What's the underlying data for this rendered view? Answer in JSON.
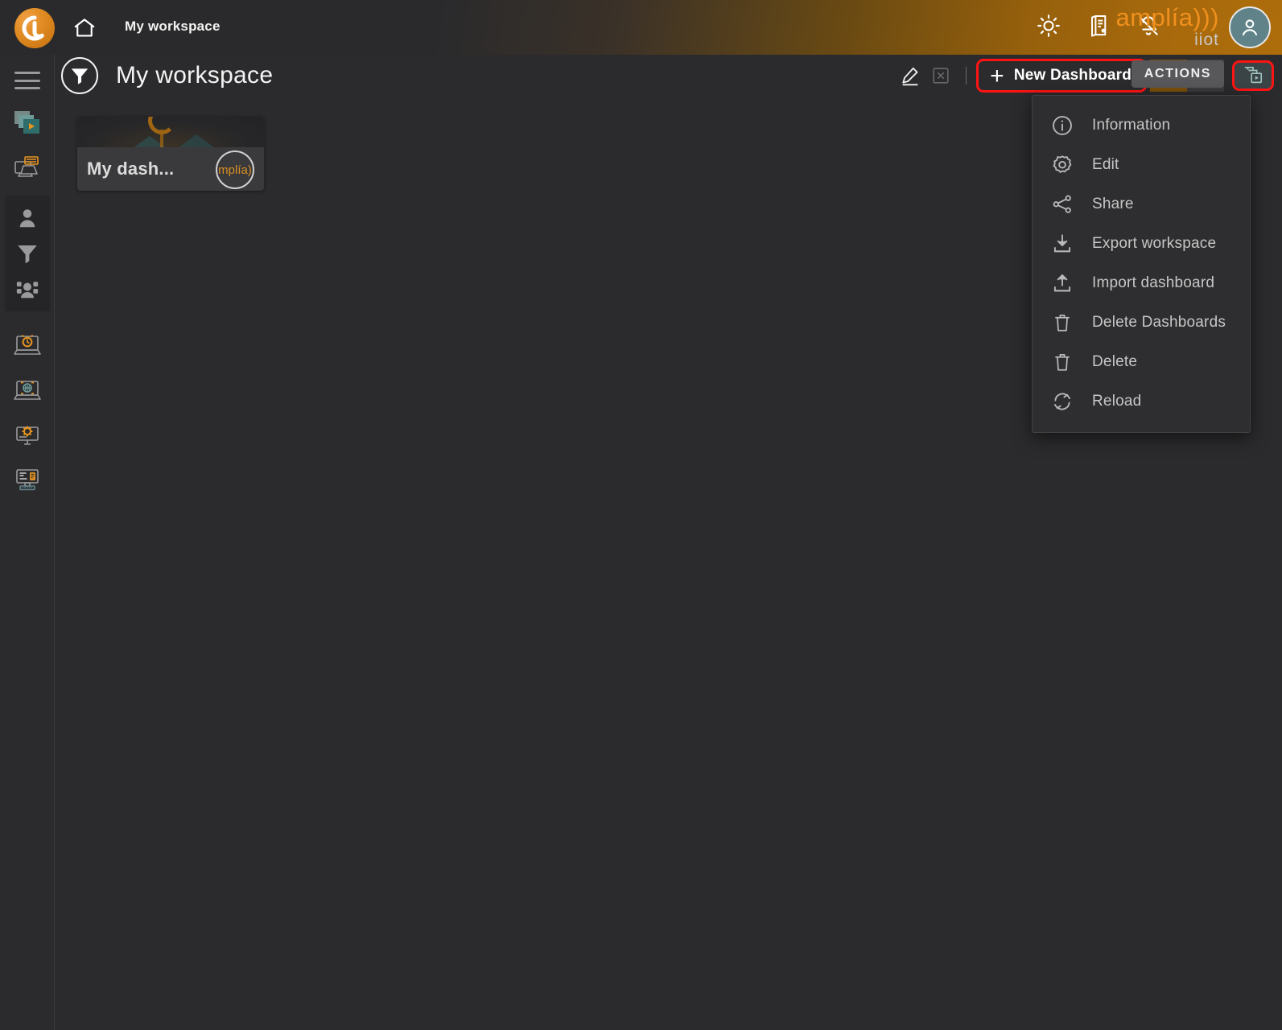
{
  "topbar": {
    "logo_icon": "amplia-orb-logo",
    "home_icon": "home-icon",
    "breadcrumb": "My workspace",
    "icons": [
      {
        "name": "brightness-icon",
        "label": "Brightness"
      },
      {
        "name": "logbook-icon",
        "label": "Logbook"
      },
      {
        "name": "bell-off-icon",
        "label": "Notifications muted"
      }
    ],
    "brand_main": "amplía)))",
    "brand_sub": "iiot",
    "avatar_icon": "user-avatar-icon"
  },
  "sidebar": {
    "menu_toggle_icon": "hamburger-icon",
    "items": [
      {
        "name": "sidebar-item-dashboards",
        "icon": "layers-play-icon"
      },
      {
        "name": "sidebar-item-reports",
        "icon": "monitor-folder-icon"
      },
      {
        "name": "sidebar-item-users",
        "icon": "person-icon"
      },
      {
        "name": "sidebar-item-filters",
        "icon": "funnel-icon"
      },
      {
        "name": "sidebar-item-groups",
        "icon": "people-group-icon"
      },
      {
        "name": "sidebar-item-devices",
        "icon": "monitor-alarm-icon"
      },
      {
        "name": "sidebar-item-network",
        "icon": "monitor-globe-icon"
      },
      {
        "name": "sidebar-item-settings",
        "icon": "monitor-gear-icon"
      },
      {
        "name": "sidebar-item-terminal",
        "icon": "desktop-terminal-icon"
      }
    ]
  },
  "page": {
    "workspace_icon": "funnel-circle-icon",
    "title": "My workspace"
  },
  "toolbar": {
    "edit_icon": "pencil-icon",
    "close_icon": "close-box-icon",
    "new_dashboard_label": "New Dashboard",
    "new_dashboard_plus": "+",
    "grid_icon": "table-grid-icon",
    "clipboard_icon": "clipboard-icon",
    "actions_tooltip": "ACTIONS",
    "layers_icon": "layers-play-icon",
    "highlight_color": "#ff1414",
    "grid_active_bg": "#7b4f0b"
  },
  "dashboards": [
    {
      "name": "dashboard-card",
      "title": "My dash...",
      "badge_text": "mplía)"
    }
  ],
  "menu": {
    "items": [
      {
        "name": "menu-item-information",
        "icon": "info-circle-icon",
        "label": "Information"
      },
      {
        "name": "menu-item-edit",
        "icon": "gear-icon",
        "label": "Edit"
      },
      {
        "name": "menu-item-share",
        "icon": "share-nodes-icon",
        "label": "Share"
      },
      {
        "name": "menu-item-export-workspace",
        "icon": "download-icon",
        "label": "Export workspace"
      },
      {
        "name": "menu-item-import-dashboard",
        "icon": "upload-icon",
        "label": "Import dashboard"
      },
      {
        "name": "menu-item-delete-dashboards",
        "icon": "trash-icon",
        "label": "Delete Dashboards"
      },
      {
        "name": "menu-item-delete",
        "icon": "trash-icon",
        "label": "Delete"
      },
      {
        "name": "menu-item-reload",
        "icon": "refresh-icon",
        "label": "Reload"
      }
    ]
  },
  "colors": {
    "brand_orange": "#f0901e",
    "accent_highlight": "#ff1414",
    "bg_dark": "#2b2b2d",
    "panel": "#2e2e30",
    "avatar_teal": "#5f8389"
  }
}
